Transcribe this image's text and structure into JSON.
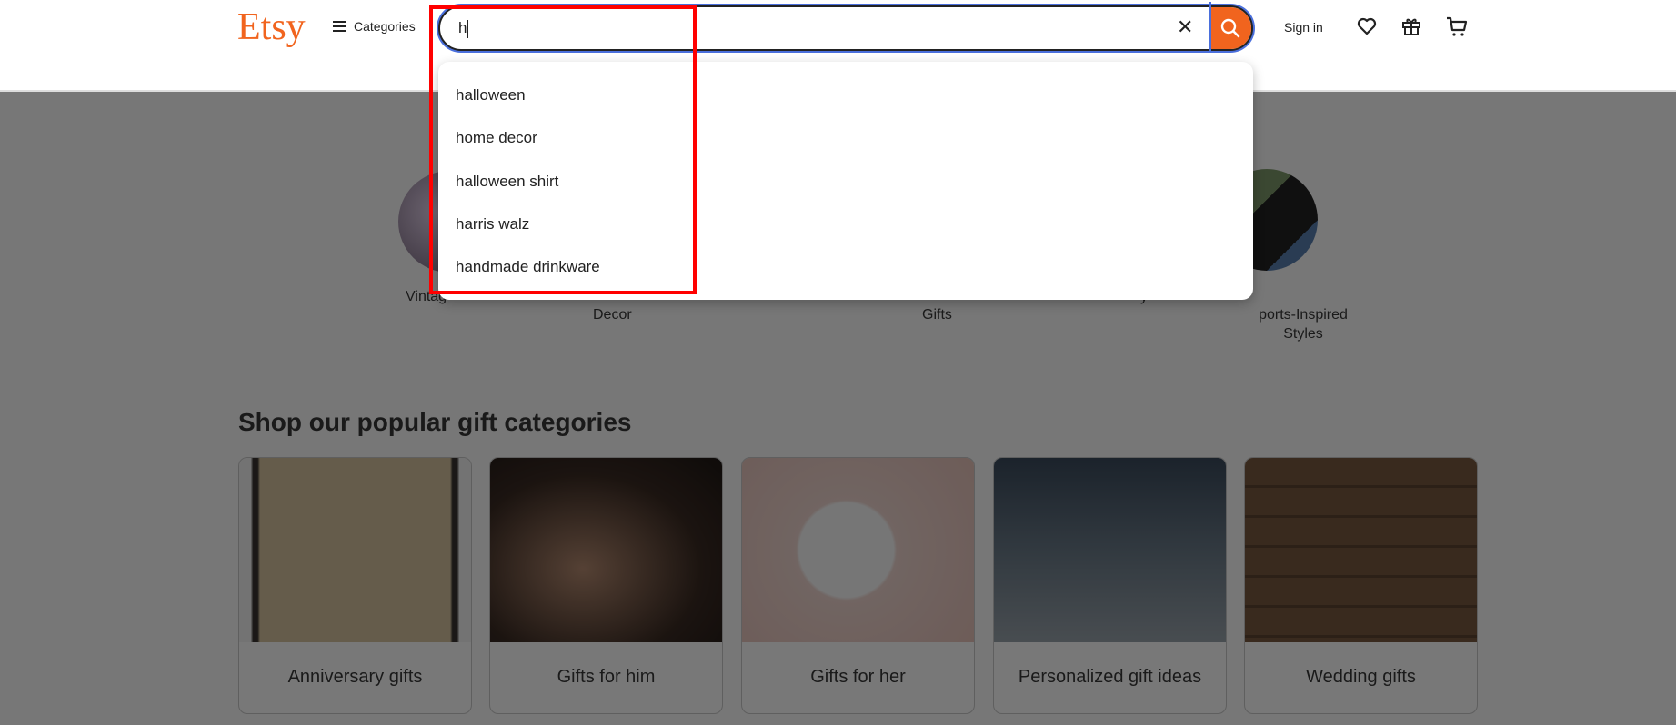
{
  "header": {
    "logo": "Etsy",
    "categories_label": "Categories",
    "search_value": "h",
    "sign_in": "Sign in",
    "brand_color": "#f1641e",
    "icons": [
      "menu-icon",
      "close-icon",
      "search-icon",
      "heart-icon",
      "gift-icon",
      "cart-icon"
    ]
  },
  "suggestions": [
    "halloween",
    "home decor",
    "halloween shirt",
    "harris walz",
    "handmade drinkware"
  ],
  "circles": [
    {
      "label": "Vintag"
    },
    {
      "label": "Decor"
    },
    {
      "label": "Gifts"
    },
    {
      "label": "y"
    },
    {
      "label": "ports-Inspired Styles"
    }
  ],
  "section": {
    "title": "Shop our popular gift categories"
  },
  "cards": [
    {
      "label": "Anniversary gifts"
    },
    {
      "label": "Gifts for him"
    },
    {
      "label": "Gifts for her"
    },
    {
      "label": "Personalized gift ideas"
    },
    {
      "label": "Wedding gifts"
    }
  ]
}
